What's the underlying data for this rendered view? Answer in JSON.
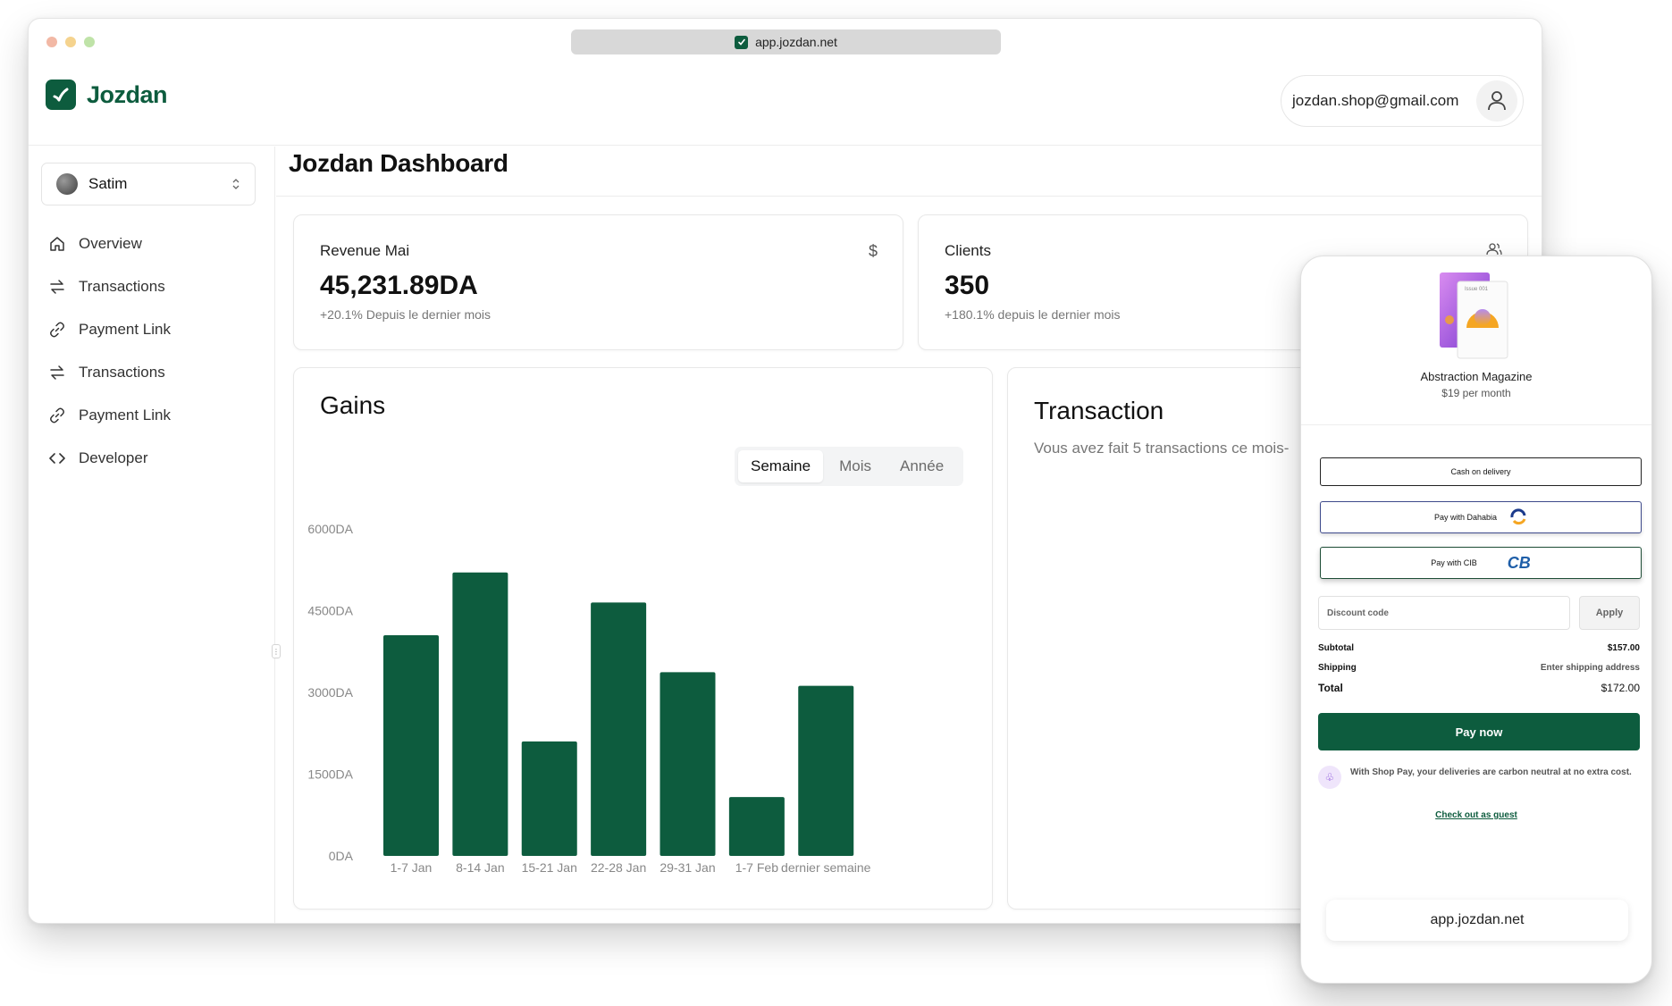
{
  "browser": {
    "url": "app.jozdan.net"
  },
  "brand": {
    "name": "Jozdan"
  },
  "user": {
    "email": "jozdan.shop@gmail.com"
  },
  "store": {
    "name": "Satim"
  },
  "sidebar": {
    "items": [
      {
        "label": "Overview",
        "icon": "home-icon"
      },
      {
        "label": "Transactions",
        "icon": "arrows-icon"
      },
      {
        "label": "Payment Link",
        "icon": "link-icon"
      },
      {
        "label": "Transactions",
        "icon": "arrows-icon"
      },
      {
        "label": "Payment Link",
        "icon": "link-icon"
      },
      {
        "label": "Developer",
        "icon": "code-icon"
      }
    ]
  },
  "page": {
    "title": "Jozdan Dashboard"
  },
  "cards": {
    "revenue": {
      "label": "Revenue Mai",
      "value": "45,231.89DA",
      "sub": "+20.1% Depuis le dernier mois",
      "icon": "dollar-icon"
    },
    "clients": {
      "label": "Clients",
      "value": "350",
      "sub": "+180.1% depuis le dernier mois",
      "icon": "users-icon"
    }
  },
  "gains": {
    "title": "Gains",
    "tabs": [
      "Semaine",
      "Mois",
      "Année"
    ],
    "active_tab": "Semaine"
  },
  "chart_data": {
    "type": "bar",
    "title": "Gains",
    "categories": [
      "1-7 Jan",
      "8-14 Jan",
      "15-21 Jan",
      "22-28 Jan",
      "29-31 Jan",
      "1-7 Feb",
      "dernier semaine"
    ],
    "values": [
      4050,
      5200,
      2100,
      4650,
      3370,
      1080,
      3120
    ],
    "y_ticks": [
      "0DA",
      "1500DA",
      "3000DA",
      "4500DA",
      "6000DA"
    ],
    "ylim": [
      0,
      6000
    ],
    "bar_color": "#0d5c3e",
    "grid": false
  },
  "transaction": {
    "title": "Transaction",
    "sub": "Vous avez fait 5 transactions ce mois-"
  },
  "checkout": {
    "product_name": "Abstraction Magazine",
    "product_price": "$19 per month",
    "cover_label": "Issue 001",
    "cash_label": "Cash on delivery",
    "dahabia_label": "Pay with Dahabia",
    "cib_label": "Pay with CIB",
    "cib_logo": "CB",
    "discount_placeholder": "Discount code",
    "apply_label": "Apply",
    "subtotal_label": "Subtotal",
    "subtotal_value": "$157.00",
    "shipping_label": "Shipping",
    "shipping_value": "Enter shipping address",
    "total_label": "Total",
    "total_value": "$172.00",
    "pay_now_label": "Pay now",
    "shoppay_note": "With Shop Pay, your deliveries are carbon neutral at no extra cost.",
    "guest_label": "Check out as guest",
    "url": "app.jozdan.net"
  },
  "colors": {
    "brand": "#0d5c3e"
  }
}
